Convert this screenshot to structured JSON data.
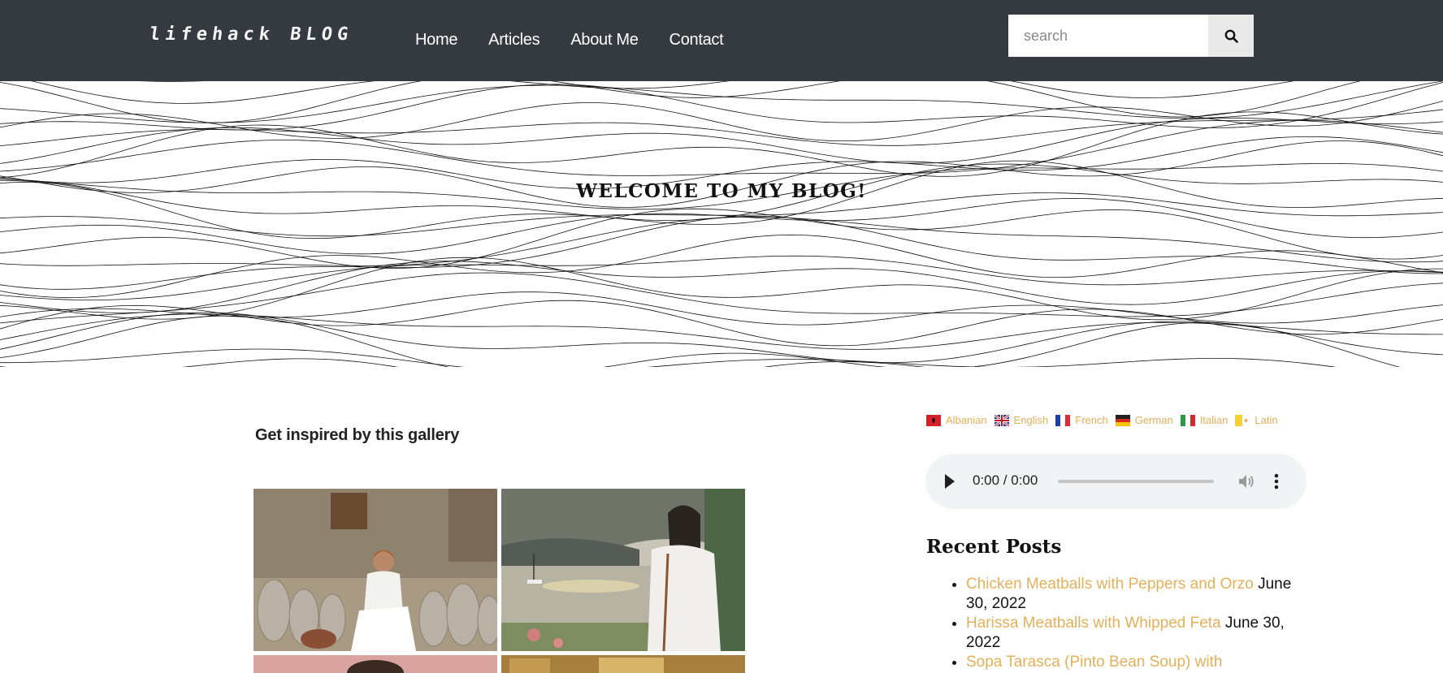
{
  "header": {
    "logo": "lifehack BLOG",
    "nav": [
      {
        "label": "Home"
      },
      {
        "label": "Articles"
      },
      {
        "label": "About Me"
      },
      {
        "label": "Contact"
      }
    ],
    "search": {
      "placeholder": "search",
      "value": "",
      "icon": "search-icon"
    }
  },
  "hero": {
    "title": "WELCOME TO MY BLOG!",
    "background": "wavy-line-pattern"
  },
  "main": {
    "gallery_heading": "Get inspired by this gallery",
    "photos": [
      {
        "alt": "Woman in white sitting among clay pots"
      },
      {
        "alt": "Woman by a bay with sailboats"
      },
      {
        "alt": "Woman against a pink background"
      },
      {
        "alt": "Warm toned interior"
      }
    ]
  },
  "sidebar": {
    "languages": [
      {
        "label": "Albanian",
        "flag": "albania-flag-icon"
      },
      {
        "label": "English",
        "flag": "uk-flag-icon"
      },
      {
        "label": "French",
        "flag": "france-flag-icon"
      },
      {
        "label": "German",
        "flag": "germany-flag-icon"
      },
      {
        "label": "Italian",
        "flag": "italy-flag-icon"
      },
      {
        "label": "Latin",
        "flag": "vatican-flag-icon"
      }
    ],
    "audio": {
      "time": "0:00 / 0:00"
    },
    "recent_posts_title": "Recent Posts",
    "recent_posts": [
      {
        "title": "Chicken Meatballs with Peppers and Orzo",
        "date": "June 30, 2022"
      },
      {
        "title": "Harissa Meatballs with Whipped Feta",
        "date": "June 30, 2022"
      },
      {
        "title": "Sopa Tarasca (Pinto Bean Soup) with",
        "date": ""
      }
    ]
  },
  "colors": {
    "header_bg": "#343a40",
    "link_accent": "#e3b15a",
    "audio_bg": "#f1f3f4"
  }
}
